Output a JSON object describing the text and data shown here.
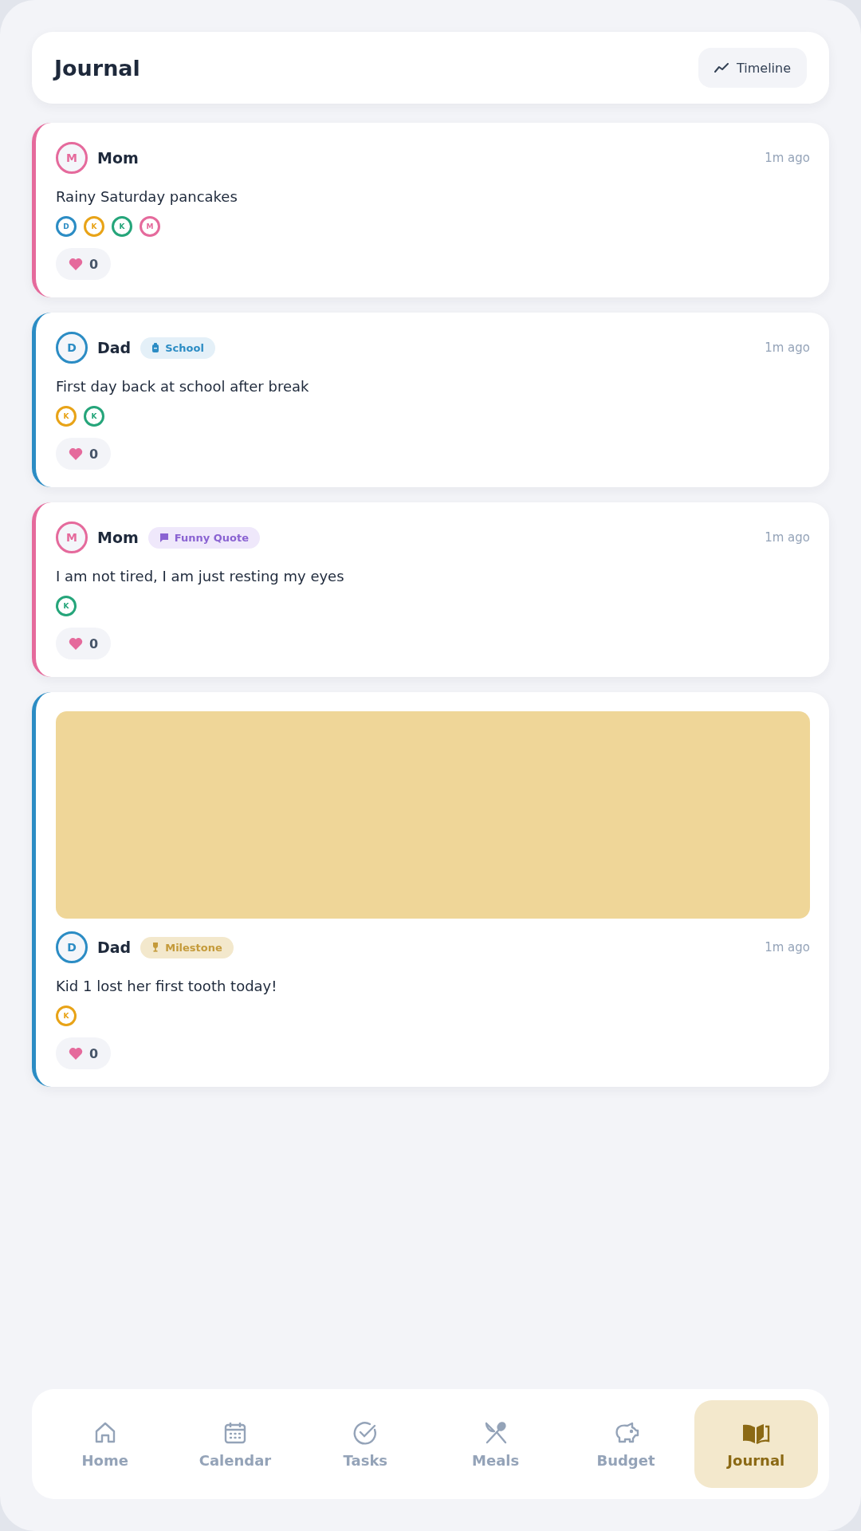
{
  "header": {
    "title": "Journal",
    "button": "Timeline"
  },
  "posts": [
    {
      "color": "#e56a9c",
      "avatar": "M",
      "author": "Mom",
      "time": "1m ago",
      "text": "Rainy Saturday pancakes",
      "tagged": [
        {
          "initial": "D",
          "color": "#2b8cc4"
        },
        {
          "initial": "K",
          "color": "#e8a317"
        },
        {
          "initial": "K",
          "color": "#25a57a"
        },
        {
          "initial": "M",
          "color": "#e56a9c"
        }
      ],
      "likes": "0"
    },
    {
      "color": "#2b8cc4",
      "avatar": "D",
      "author": "Dad",
      "tag": {
        "kind": "school",
        "label": "School"
      },
      "time": "1m ago",
      "text": "First day back at school after break",
      "tagged": [
        {
          "initial": "K",
          "color": "#e8a317"
        },
        {
          "initial": "K",
          "color": "#25a57a"
        }
      ],
      "likes": "0"
    },
    {
      "color": "#e56a9c",
      "avatar": "M",
      "author": "Mom",
      "tag": {
        "kind": "quote",
        "label": "Funny Quote"
      },
      "time": "1m ago",
      "text": "I am not tired, I am just resting my eyes",
      "tagged": [
        {
          "initial": "K",
          "color": "#25a57a"
        }
      ],
      "likes": "0"
    },
    {
      "color": "#2b8cc4",
      "photo": {
        "kind": "picture"
      },
      "avatar": "D",
      "author": "Dad",
      "tag": {
        "kind": "milestone",
        "label": "Milestone"
      },
      "time": "1m ago",
      "text": "Kid 1 lost her first tooth today!",
      "tagged": [
        {
          "initial": "K",
          "color": "#e8a317"
        }
      ],
      "likes": "0"
    }
  ],
  "nav": [
    {
      "kind": "home",
      "label": "Home",
      "selected": false
    },
    {
      "kind": "calendar",
      "label": "Calendar",
      "selected": false
    },
    {
      "kind": "tasks",
      "label": "Tasks",
      "selected": false
    },
    {
      "kind": "meals",
      "label": "Meals",
      "selected": false
    },
    {
      "kind": "budget",
      "label": "Budget",
      "selected": false
    },
    {
      "kind": "journal",
      "label": "Journal",
      "selected": true
    }
  ]
}
